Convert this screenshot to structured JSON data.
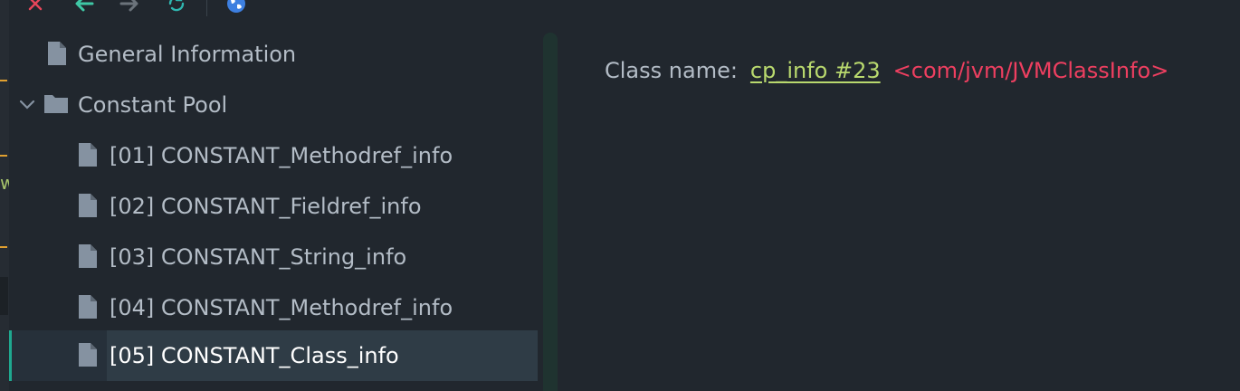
{
  "toolbar": {
    "buttons": [
      {
        "name": "close",
        "icon": "close-icon",
        "color": "#e8455a"
      },
      {
        "name": "back",
        "icon": "arrow-left-icon",
        "color": "#3fc7a5"
      },
      {
        "name": "forward",
        "icon": "arrow-right-icon",
        "color": "#6b737b"
      },
      {
        "name": "refresh",
        "icon": "refresh-icon",
        "color": "#2fb6b0"
      },
      {
        "name": "web",
        "icon": "globe-icon",
        "color": "#3d7fe0"
      }
    ]
  },
  "tree": {
    "items": [
      {
        "label": "General Information",
        "icon": "file-icon",
        "level": 0,
        "selected": false
      },
      {
        "label": "Constant Pool",
        "icon": "folder-icon",
        "level": 0,
        "expanded": true,
        "selected": false
      },
      {
        "label": "[01] CONSTANT_Methodref_info",
        "icon": "file-icon",
        "level": 1,
        "selected": false
      },
      {
        "label": "[02] CONSTANT_Fieldref_info",
        "icon": "file-icon",
        "level": 1,
        "selected": false
      },
      {
        "label": "[03] CONSTANT_String_info",
        "icon": "file-icon",
        "level": 1,
        "selected": false
      },
      {
        "label": "[04] CONSTANT_Methodref_info",
        "icon": "file-icon",
        "level": 1,
        "selected": false
      },
      {
        "label": "[05] CONSTANT_Class_info",
        "icon": "file-icon",
        "level": 1,
        "selected": true
      }
    ]
  },
  "details": {
    "label": "Class name:",
    "link_text": "cp_info #23",
    "value": "<com/jvm/JVMClassInfo>"
  },
  "colors": {
    "background": "#21272e",
    "selection": "#2f3c46",
    "accent": "#1fa88f",
    "link": "#b9d96e",
    "reference": "#ee3f60"
  }
}
